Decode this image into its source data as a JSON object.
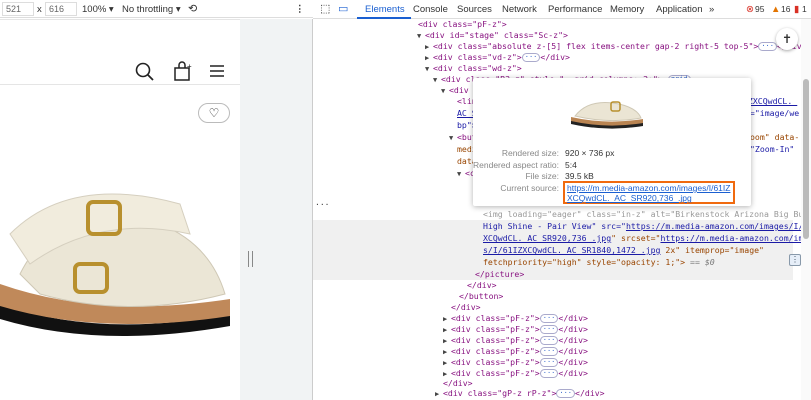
{
  "device_toolbar": {
    "width": "521",
    "height": "616",
    "times": "x",
    "zoom": "100% ▾",
    "throttling": "No throttling ▾"
  },
  "devtools": {
    "tabs": [
      "Elements",
      "Console",
      "Sources",
      "Network",
      "Performance",
      "Memory",
      "Application"
    ],
    "more": "»",
    "errors": "95",
    "warnings": "16",
    "issues": "1"
  },
  "tooltip": {
    "rendered_size_label": "Rendered size:",
    "rendered_size": "920 × 736 px",
    "aspect_label": "Rendered aspect ratio:",
    "aspect": "5:4",
    "file_size_label": "File size:",
    "file_size": "39.5 kB",
    "source_label": "Current source:",
    "source": "https://m.media-amazon.com/images/I/61IZXCQwdCL._AC_SR920,736_.jpg"
  },
  "code": {
    "l0": "<div class=\"pF-z\">",
    "l1": "<div id=\"stage\" class=\"Sc-z\">",
    "l2": "<div class=\"absolute z-[5] flex items-center gap-2 right-5 top-5\">",
    "l3": "<div class=\"vd-z\">",
    "l4": "<div class=\"wd-z\">",
    "l5": "<div class=\"B3-z\" style=\"--grid-columns: 2;\">",
    "grid_badge": "grid",
    "l6": "<div c",
    "l7a": "<lin",
    "l7b": "IZXCQwdCL._",
    "l8a": "AC_S",
    "l8b": "e=\"image/we",
    "l9": "bp\">",
    "l10a": "<but",
    "l10b": "oom\" data-",
    "l11a": "medi",
    "l11b": "\"Zoom-In\"",
    "l12": "data",
    "l13": "<c",
    "img1": "<img loading=\"eager\" class=\"in-z\" alt=\"Birkenstock Arizona Big Buckle",
    "img2a": "High Shine - Pair View\" src=\"",
    "img2b": "https://m.media-amazon.com/images/I/61IZ",
    "img3a": "XCQwdCL._AC_SR920,736_.jpg",
    "img3b": "\" srcset=\"",
    "img3c": "https://m.media-amazon.com/image",
    "img4a": "s/I/61IZXCQwdCL._AC_SR1840,1472_.jpg",
    "img4b": " 2x\" itemprop=\"image\"",
    "img5": "fetchpriority=\"high\" style=\"opacity: 1;\">",
    "eq": " == $0",
    "picture_close": "</picture>",
    "div_close": "</div>",
    "button_close": "</button>",
    "pf": "<div class=\"pF-z\">",
    "div_end": "</div>",
    "last": "<div class=\"gP-z rP-z\">",
    "ellipsis": "···"
  }
}
